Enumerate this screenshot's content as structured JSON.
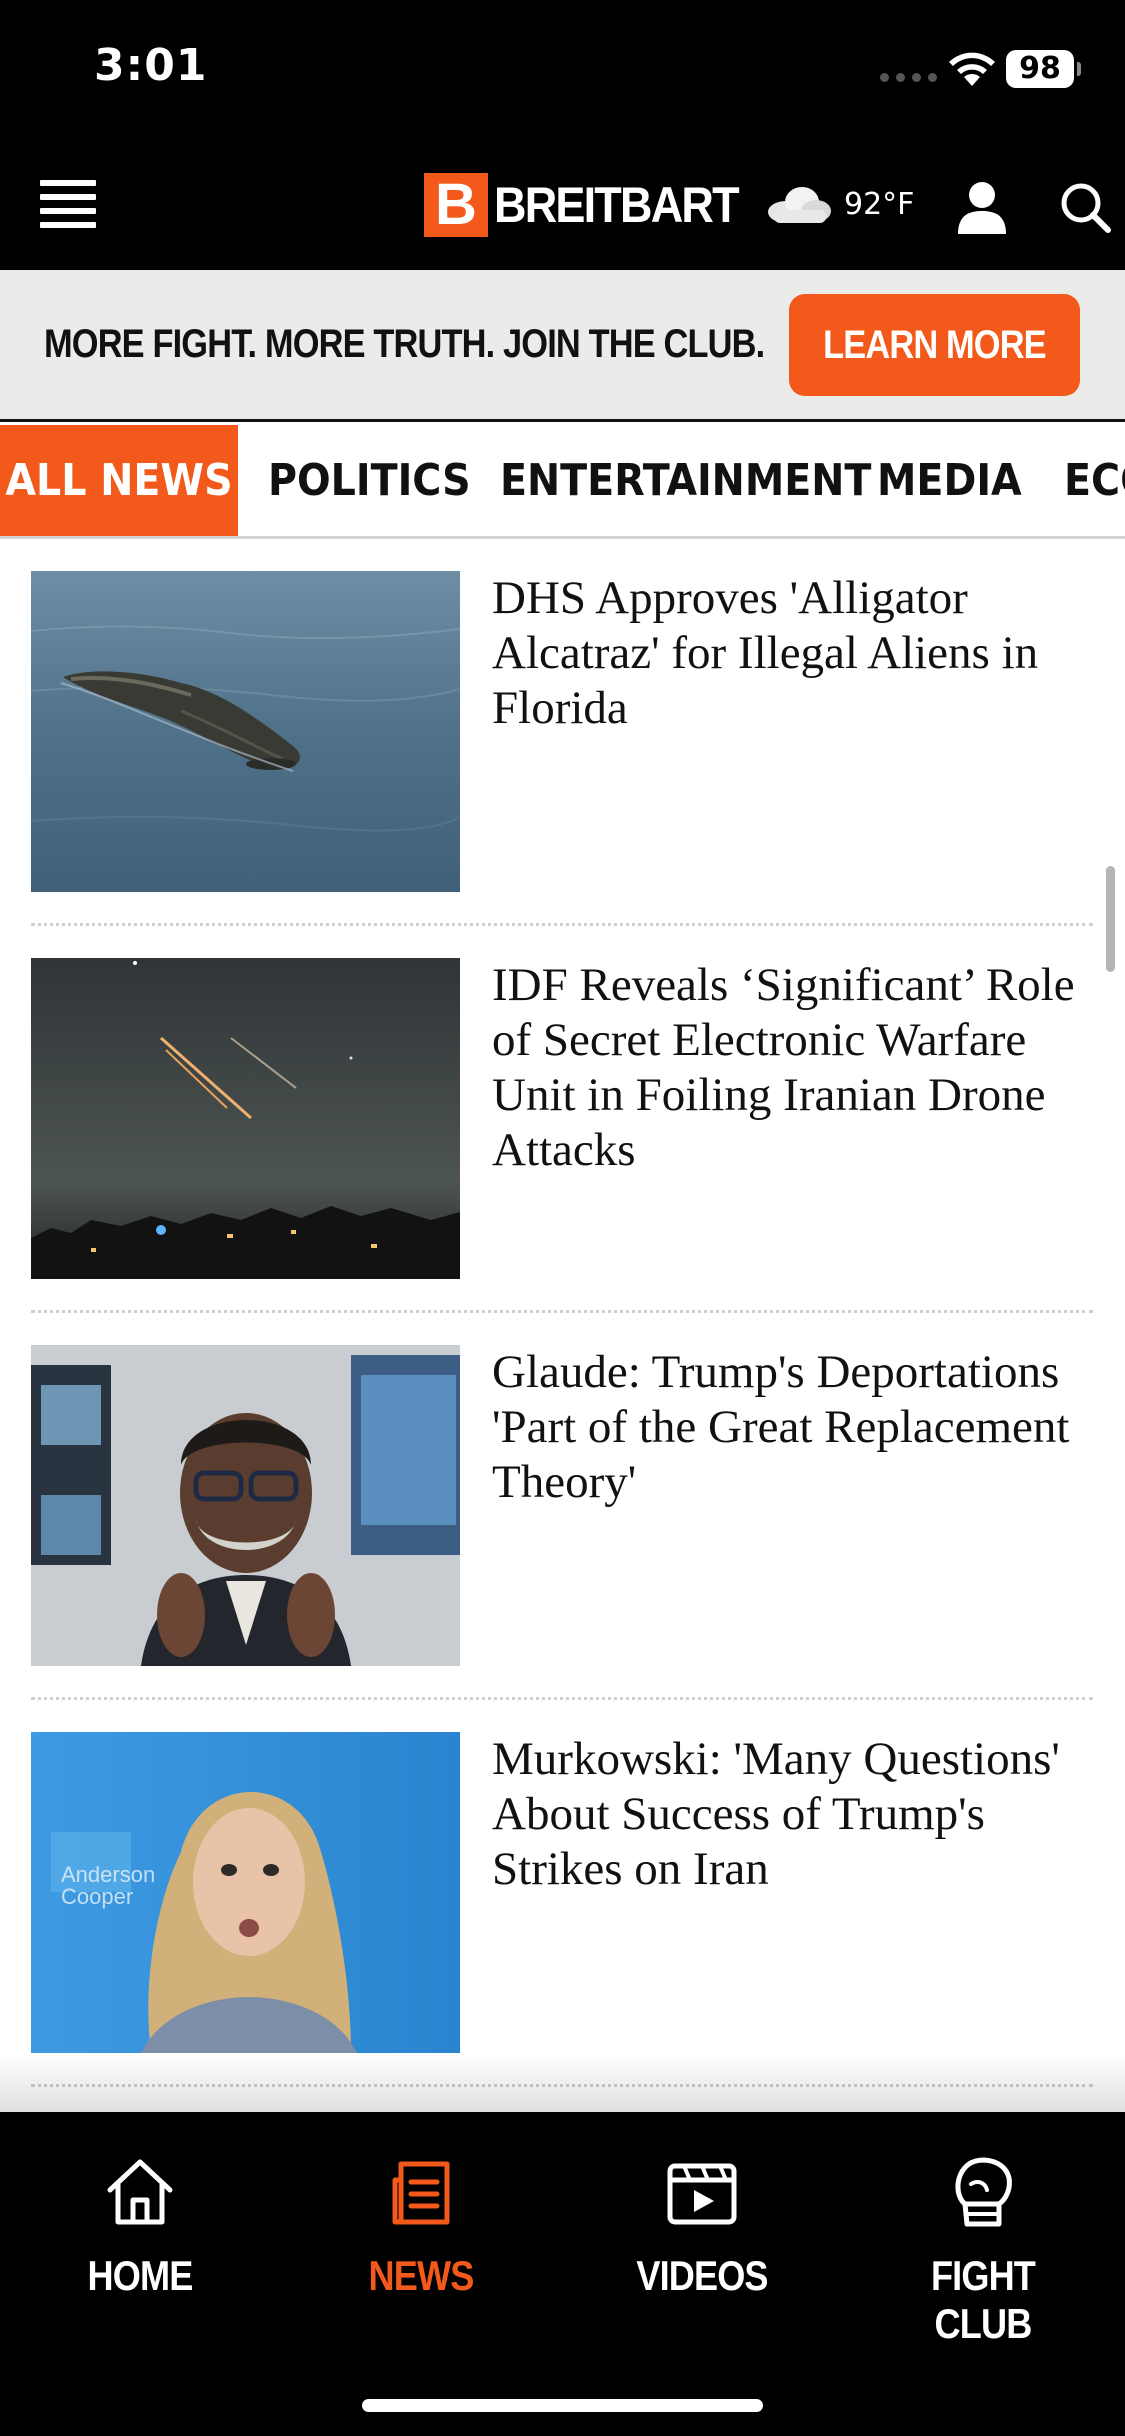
{
  "status_bar": {
    "time": "3:01",
    "battery": "98"
  },
  "header": {
    "brand_mark": "B",
    "brand_name": "BREITBART",
    "weather_icon": "cloud-icon",
    "temperature": "92°F",
    "icons": [
      "menu-icon",
      "user-icon",
      "search-icon"
    ]
  },
  "promo": {
    "text": "MORE FIGHT. MORE TRUTH. JOIN THE CLUB.",
    "button_label": "LEARN MORE"
  },
  "tabs": [
    {
      "label": "ALL NEWS",
      "active": true
    },
    {
      "label": "POLITICS",
      "active": false
    },
    {
      "label": "ENTERTAINMENT",
      "active": false
    },
    {
      "label": "MEDIA",
      "active": false
    },
    {
      "label": "ECO",
      "active": false
    }
  ],
  "articles": [
    {
      "headline": "DHS Approves 'Alligator Alcatraz' for Illegal Aliens in Florida",
      "image": "alligator-photo"
    },
    {
      "headline": "IDF Reveals ‘Significant’ Role of Secret Electronic Warfare Unit in Foiling Iranian Drone Attacks",
      "image": "night-sky-missiles-photo"
    },
    {
      "headline": "Glaude: Trump's Deportations 'Part of the Great Replacement Theory'",
      "image": "tv-interview-man-photo"
    },
    {
      "headline": "Murkowski: 'Many Questions' About Success of Trump's Strikes on Iran",
      "image": "tv-interview-woman-photo"
    }
  ],
  "bottom_nav": [
    {
      "label": "HOME",
      "icon": "home-icon",
      "active": false
    },
    {
      "label": "NEWS",
      "icon": "news-icon",
      "active": true
    },
    {
      "label": "VIDEOS",
      "icon": "video-icon",
      "active": false
    },
    {
      "label": "FIGHT CLUB",
      "icon": "boxing-glove-icon",
      "active": false
    }
  ],
  "colors": {
    "accent": "#f2591a",
    "header_bg": "#000000",
    "promo_bg": "#ebebea"
  }
}
